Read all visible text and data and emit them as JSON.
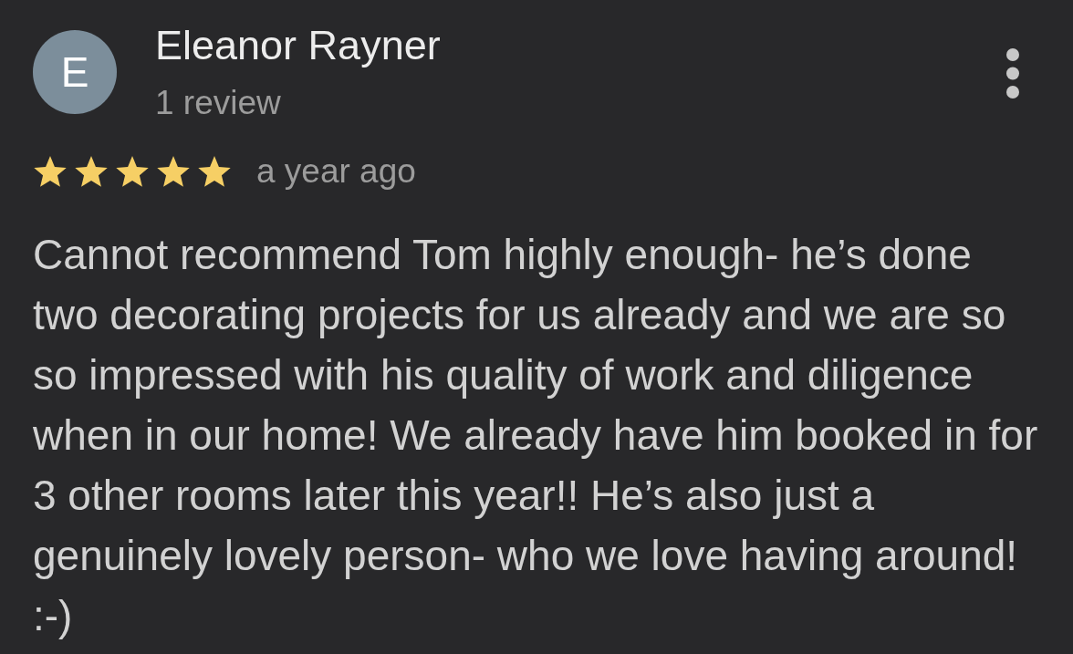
{
  "review": {
    "avatar_letter": "E",
    "author": "Eleanor Rayner",
    "review_count": "1 review",
    "stars": 5,
    "time": "a year ago",
    "text": "Cannot recommend Tom highly enough- he’s done two decorating projects for us already and we are so so impressed with his quality of work and diligence when in our home! We already have him booked in for 3 other rooms later this year!! He’s also just a genuinely lovely person- who we love having around! :-)"
  }
}
